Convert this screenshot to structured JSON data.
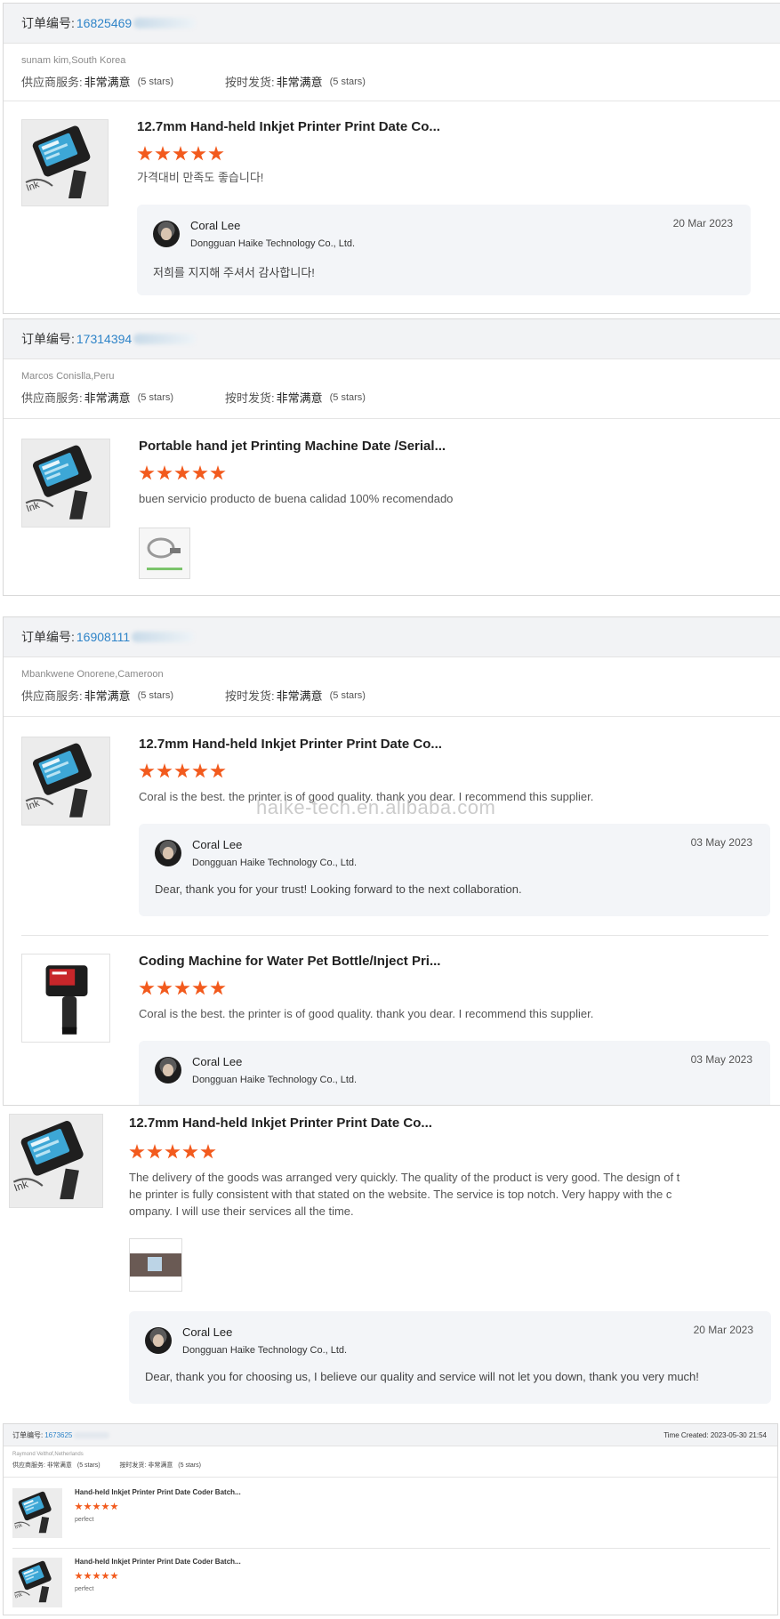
{
  "orders": [
    {
      "label": "订单编号:",
      "number": "16825469",
      "buyer": "sunam kim,South Korea",
      "service_label": "供应商服务:",
      "service_value": "非常满意",
      "service_stars": "(5 stars)",
      "ship_label": "按时发货:",
      "ship_value": "非常满意",
      "ship_stars": "(5 stars)",
      "item": {
        "title": "12.7mm Hand-held Inkjet Printer Print Date Co...",
        "rating": 5,
        "review": "가격대비 만족도 좋습니다!",
        "reply": {
          "name": "Coral Lee",
          "company": "Dongguan Haike Technology Co., Ltd.",
          "date": "20 Mar 2023",
          "text": "저희를 지지해 주셔서 감사합니다!"
        }
      }
    },
    {
      "label": "订单编号:",
      "number": "17314394",
      "buyer": "Marcos Conislla,Peru",
      "service_label": "供应商服务:",
      "service_value": "非常满意",
      "service_stars": "(5 stars)",
      "ship_label": "按时发货:",
      "ship_value": "非常满意",
      "ship_stars": "(5 stars)",
      "item": {
        "title": "Portable hand jet Printing Machine Date /Serial...",
        "rating": 5,
        "review": "buen servicio producto de buena calidad 100% recomendado"
      }
    },
    {
      "label": "订单编号:",
      "number": "16908111",
      "buyer": "Mbankwene Onorene,Cameroon",
      "service_label": "供应商服务:",
      "service_value": "非常满意",
      "service_stars": "(5 stars)",
      "ship_label": "按时发货:",
      "ship_value": "非常满意",
      "ship_stars": "(5 stars)",
      "items": [
        {
          "title": "12.7mm Hand-held Inkjet Printer Print Date Co...",
          "rating": 5,
          "review": "Coral is the best. the printer is of good quality. thank you dear. I recommend this supplier.",
          "reply": {
            "name": "Coral Lee",
            "company": "Dongguan Haike Technology Co., Ltd.",
            "date": "03 May 2023",
            "text": "Dear, thank you for your trust! Looking forward to the next collaboration."
          }
        },
        {
          "title": "Coding Machine for Water Pet Bottle/Inject Pri...",
          "rating": 5,
          "review": "Coral is the best. the printer is of good quality. thank you dear. I recommend this supplier.",
          "reply": {
            "name": "Coral Lee",
            "company": "Dongguan Haike Technology Co., Ltd.",
            "date": "03 May 2023"
          }
        }
      ]
    }
  ],
  "watermark": "haike-tech.en.alibaba.com",
  "standalone_review": {
    "title": "12.7mm Hand-held Inkjet Printer Print Date Co...",
    "rating": 5,
    "review_line1": "The delivery of the goods was arranged very quickly. The quality of the product is very good. The design of t",
    "review_line2": "he printer is fully consistent with that stated on the website. The service is top notch. Very happy with the c",
    "review_line3": "ompany. I will use their services all the time.",
    "reply": {
      "name": "Coral Lee",
      "company": "Dongguan Haike Technology Co., Ltd.",
      "date": "20 Mar 2023",
      "text": "Dear, thank you for choosing us, I believe our quality and service will not let you down, thank you very much!"
    }
  },
  "small_order": {
    "label": "订单编号:",
    "number": "1673625",
    "time_created": "Time Created: 2023-05-30 21:54",
    "buyer": "Raymond Velthof,Netherlands",
    "service_label": "供应商服务:",
    "service_value": "非常满意",
    "service_stars": "(5 stars)",
    "ship_label": "按时发货:",
    "ship_value": "非常满意",
    "ship_stars": "(5 stars)",
    "items": [
      {
        "title": "Hand-held Inkjet Printer Print Date Coder Batch...",
        "rating": 5,
        "review": "perfect"
      },
      {
        "title": "Hand-held Inkjet Printer Print Date Coder Batch...",
        "rating": 5,
        "review": "perfect"
      }
    ]
  },
  "colors": {
    "star": "#f25a1d",
    "order_link": "#2f84c8",
    "header_bg": "#f2f3f5",
    "reply_bg": "#f3f5f8"
  }
}
